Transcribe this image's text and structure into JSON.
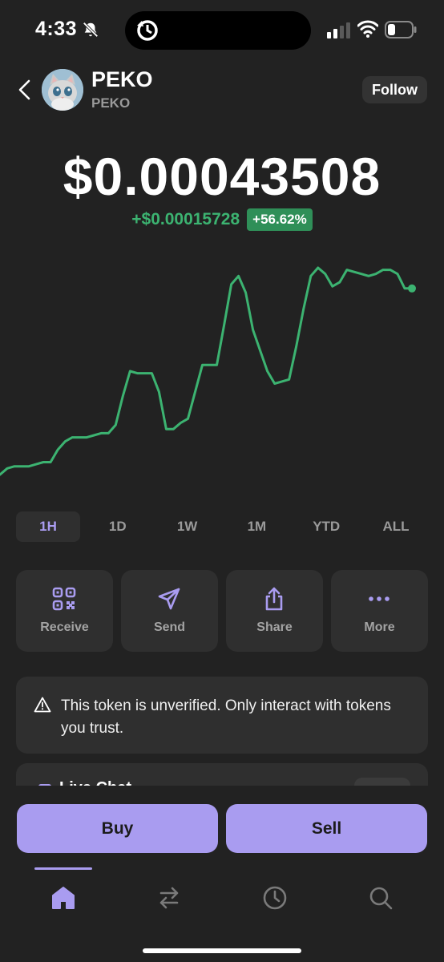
{
  "status_bar": {
    "time": "4:33"
  },
  "header": {
    "token_name": "PEKO",
    "token_symbol": "PEKO",
    "follow_label": "Follow"
  },
  "price": {
    "value": "$0.00043508",
    "change_value": "+$0.00015728",
    "change_percent": "+56.62%"
  },
  "colors": {
    "accent": "#a99cf0",
    "positive": "#3cb371",
    "background": "#222222",
    "card": "#2f2f2f"
  },
  "chart_data": {
    "type": "line",
    "title": "",
    "xlabel": "",
    "ylabel": "",
    "grid": false,
    "x": [
      0,
      1,
      2,
      3,
      4,
      5,
      6,
      7,
      8,
      9,
      10,
      11,
      12,
      13,
      14,
      15,
      16,
      17,
      18,
      19,
      20,
      21,
      22,
      23,
      24,
      25,
      26,
      27,
      28,
      29,
      30,
      31,
      32,
      33,
      34,
      35,
      36,
      37,
      38,
      39,
      40,
      41,
      42,
      43,
      44,
      45,
      46,
      47,
      48,
      49,
      50,
      51,
      52,
      53,
      54,
      55,
      56,
      57
    ],
    "series": [
      {
        "values": [
          0,
          3,
          4,
          4,
          4,
          5,
          6,
          6,
          12,
          16,
          18,
          18,
          18,
          19,
          20,
          20,
          24,
          38,
          50,
          49,
          49,
          49,
          40,
          22,
          22,
          25,
          27,
          40,
          53,
          53,
          53,
          72,
          92,
          96,
          88,
          70,
          60,
          50,
          44,
          45,
          46,
          62,
          80,
          96,
          100,
          97,
          91,
          93,
          99,
          98,
          97,
          96,
          97,
          99,
          99,
          97,
          90,
          90
        ],
        "color": "#3cb371"
      }
    ]
  },
  "range_tabs": [
    {
      "label": "1H",
      "active": true
    },
    {
      "label": "1D",
      "active": false
    },
    {
      "label": "1W",
      "active": false
    },
    {
      "label": "1M",
      "active": false
    },
    {
      "label": "YTD",
      "active": false
    },
    {
      "label": "ALL",
      "active": false
    }
  ],
  "actions": [
    {
      "label": "Receive",
      "icon": "qr-code-icon"
    },
    {
      "label": "Send",
      "icon": "send-icon"
    },
    {
      "label": "Share",
      "icon": "share-icon"
    },
    {
      "label": "More",
      "icon": "more-icon"
    }
  ],
  "warning": {
    "icon": "warning-icon",
    "text": "This token is unverified. Only interact with tokens you trust."
  },
  "peek_card": {
    "title": "Live Chat"
  },
  "trade": {
    "buy_label": "Buy",
    "sell_label": "Sell"
  },
  "nav": [
    {
      "icon": "home-icon",
      "active": true
    },
    {
      "icon": "swap-icon",
      "active": false
    },
    {
      "icon": "history-icon",
      "active": false
    },
    {
      "icon": "search-icon",
      "active": false
    }
  ]
}
